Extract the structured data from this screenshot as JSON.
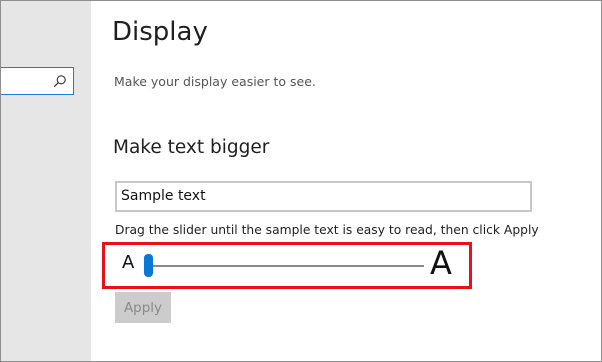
{
  "sidebar": {
    "search": {
      "value": "",
      "placeholder": "",
      "icon": "search-icon"
    }
  },
  "page": {
    "title": "Display",
    "subtitle": "Make your display easier to see."
  },
  "text_size": {
    "section_title": "Make text bigger",
    "sample_text": "Sample text",
    "instruction": "Drag the slider until the sample text is easy to read, then click Apply",
    "slider": {
      "min_label": "A",
      "max_label": "A",
      "value_percent": 0
    },
    "apply_label": "Apply",
    "apply_enabled": false
  },
  "colors": {
    "accent": "#0a76d6",
    "highlight_border": "#e41414",
    "disabled_button_bg": "#cccccc",
    "disabled_button_text": "#8a8a8a"
  }
}
